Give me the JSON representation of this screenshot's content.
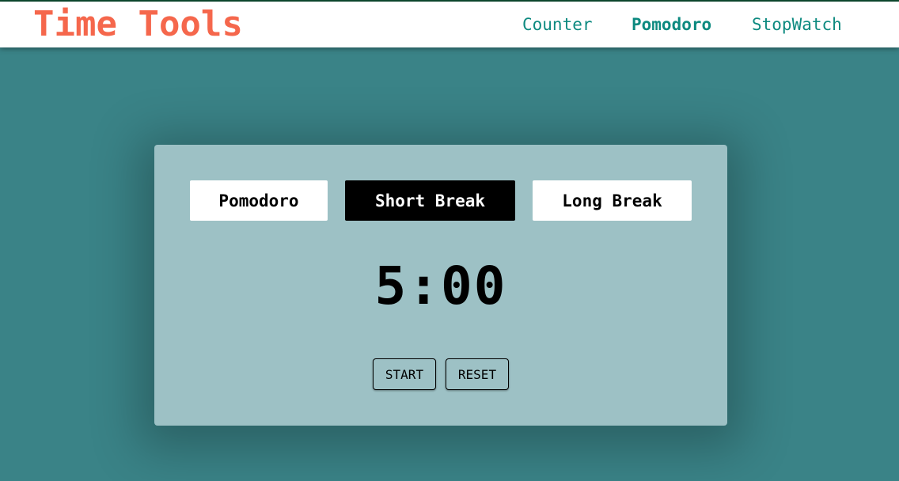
{
  "brand": {
    "title": "Time Tools",
    "color": "#f5674c"
  },
  "nav": {
    "links": [
      {
        "label": "Counter",
        "active": false
      },
      {
        "label": "Pomodoro",
        "active": true
      },
      {
        "label": "StopWatch",
        "active": false
      }
    ],
    "link_color": "#0d8a80"
  },
  "timer_card": {
    "modes": [
      {
        "label": "Pomodoro",
        "active": false
      },
      {
        "label": "Short Break",
        "active": true
      },
      {
        "label": "Long Break",
        "active": false
      }
    ],
    "display": "5:00",
    "controls": {
      "start_label": "START",
      "reset_label": "RESET"
    }
  },
  "colors": {
    "page_background": "#3a8387",
    "card_background": "#9dc1c5",
    "active_mode_background": "#000000"
  }
}
